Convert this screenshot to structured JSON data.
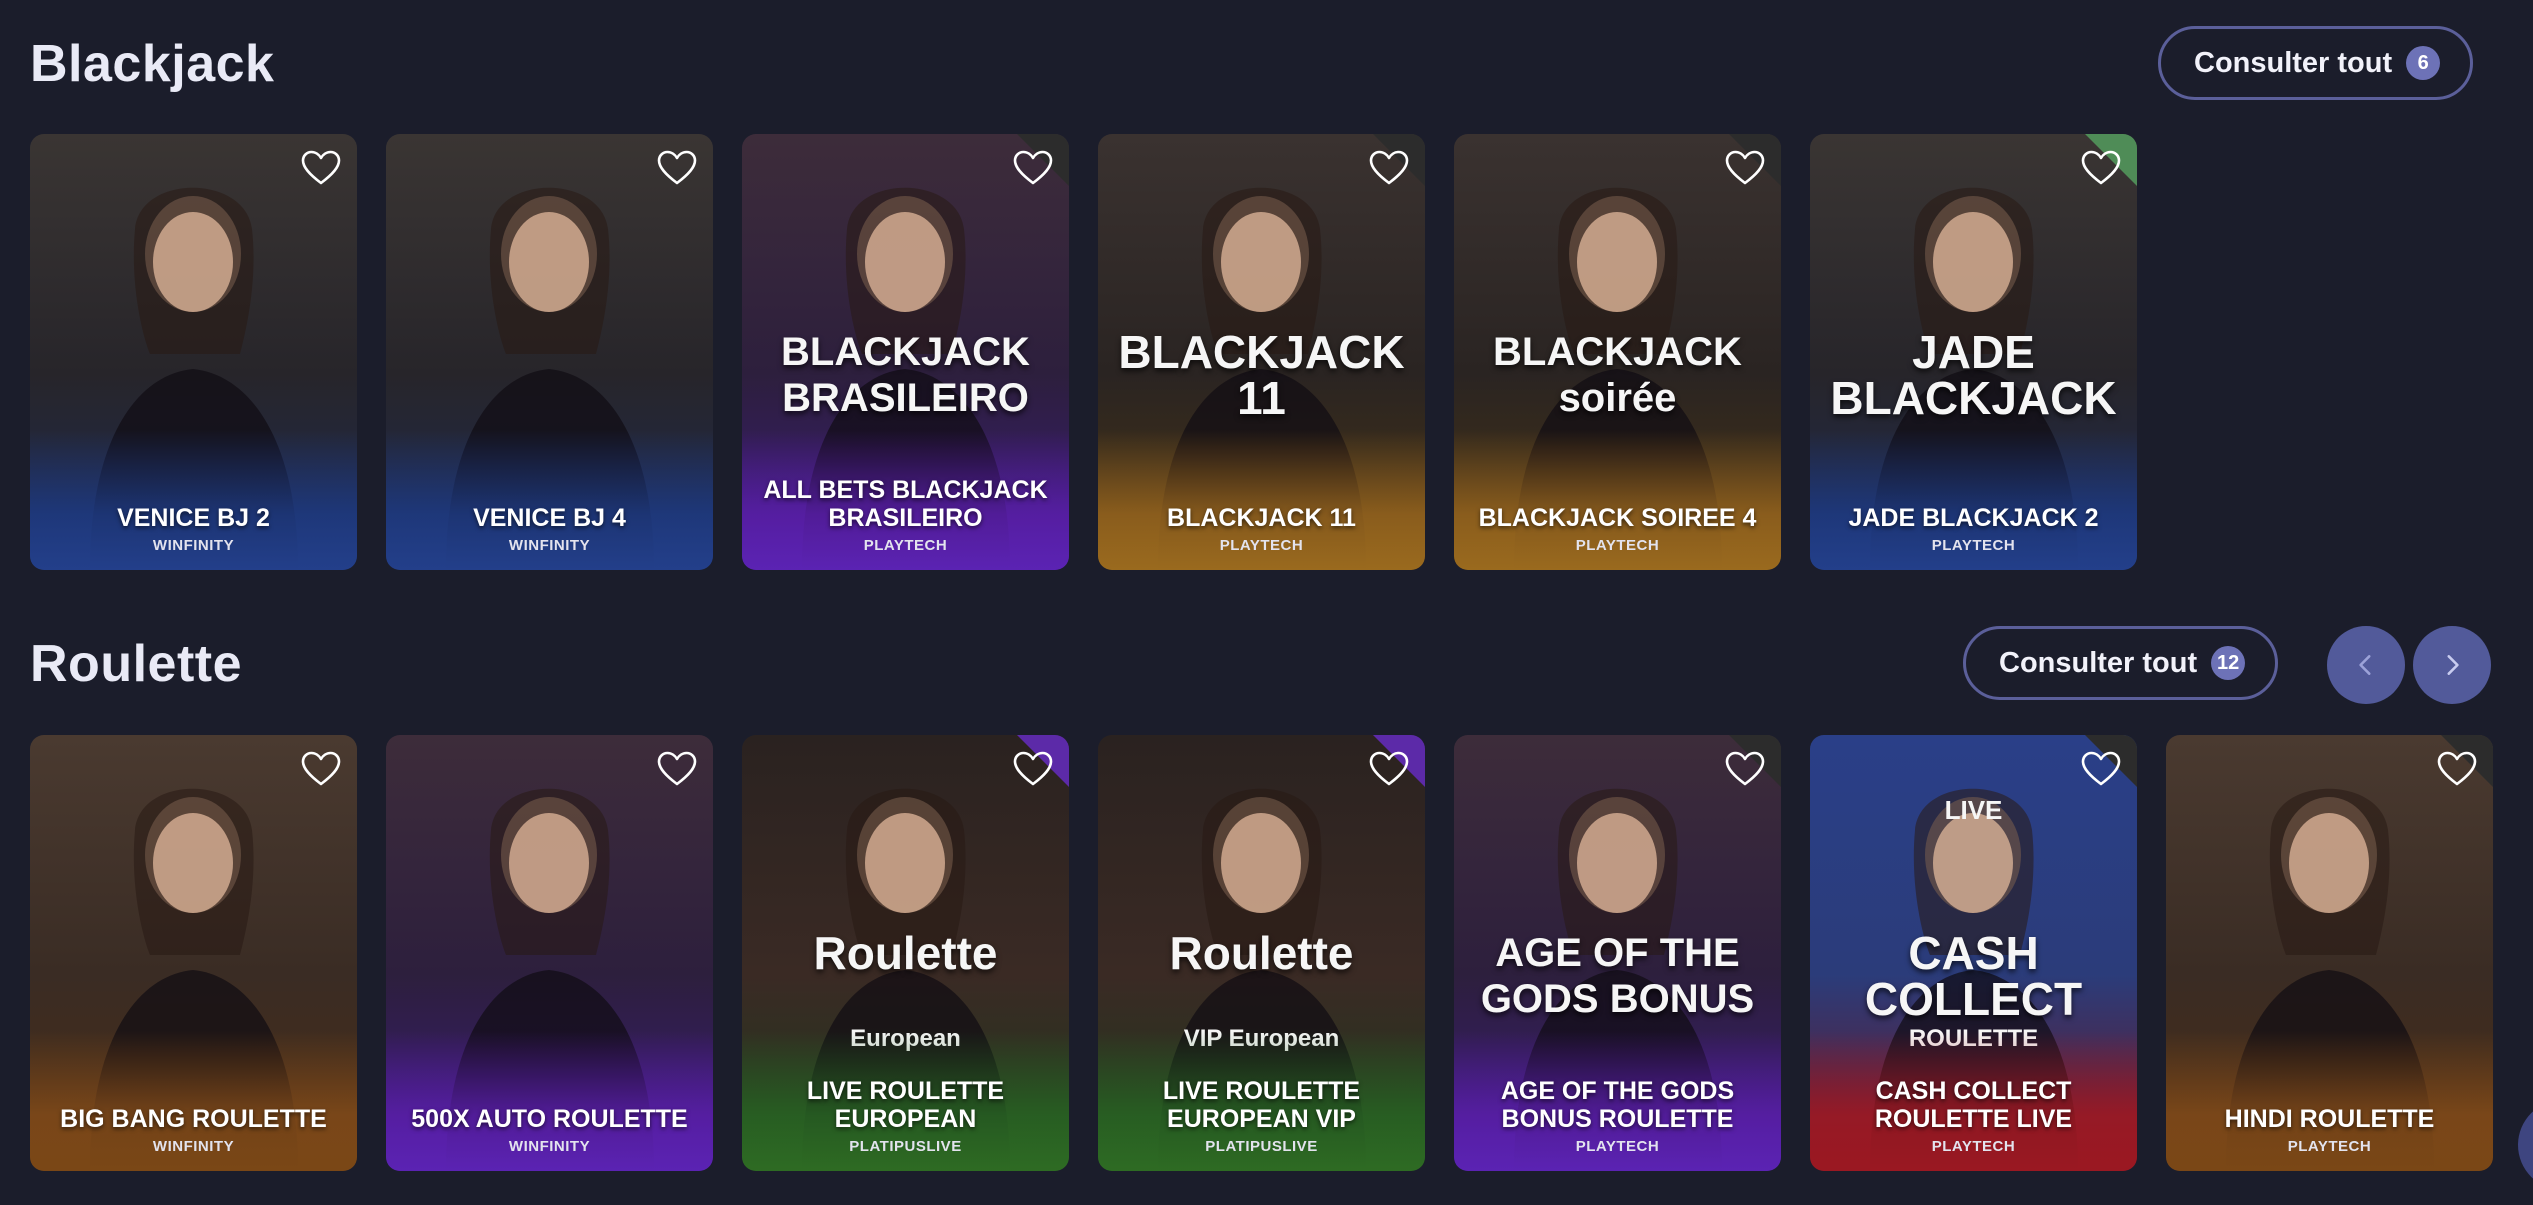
{
  "sections": [
    {
      "title": "Blackjack",
      "consult_label": "Consulter tout",
      "consult_count": "6",
      "games": [
        {
          "name": "VENICE BJ 2",
          "provider": "WINFINITY",
          "theme": "blue"
        },
        {
          "name": "VENICE BJ 4",
          "provider": "WINFINITY",
          "theme": "blue"
        },
        {
          "name": "ALL BETS BLACKJACK BRASILEIRO",
          "provider": "PLAYTECH",
          "theme": "purple",
          "logo": "BLACKJACK BRASILEIRO"
        },
        {
          "name": "BLACKJACK 11",
          "provider": "PLAYTECH",
          "theme": "gold",
          "logo": "BLACKJACK 11"
        },
        {
          "name": "BLACKJACK SOIREE 4",
          "provider": "PLAYTECH",
          "theme": "gold",
          "logo": "BLACKJACK soirée"
        },
        {
          "name": "JADE BLACKJACK 2",
          "provider": "PLAYTECH",
          "theme": "blue",
          "logo": "JADE BLACKJACK"
        }
      ]
    },
    {
      "title": "Roulette",
      "consult_label": "Consulter tout",
      "consult_count": "12",
      "games": [
        {
          "name": "BIG BANG ROULETTE",
          "provider": "WINFINITY",
          "theme": "brown"
        },
        {
          "name": "500X AUTO ROULETTE",
          "provider": "WINFINITY",
          "theme": "purple"
        },
        {
          "name": "LIVE ROULETTE EUROPEAN",
          "provider": "PLATIPUSLIVE",
          "theme": "green",
          "logo": "Roulette",
          "logo_sub": "European"
        },
        {
          "name": "LIVE ROULETTE EUROPEAN VIP",
          "provider": "PLATIPUSLIVE",
          "theme": "green",
          "logo": "Roulette",
          "logo_sub": "VIP European"
        },
        {
          "name": "AGE OF THE GODS BONUS ROULETTE",
          "provider": "PLAYTECH",
          "theme": "purple",
          "logo": "AGE OF THE GODS BONUS"
        },
        {
          "name": "CASH COLLECT ROULETTE LIVE",
          "provider": "PLAYTECH",
          "theme": "red",
          "logo": "CASH COLLECT",
          "logo_sub": "ROULETTE",
          "logo_top": "LIVE"
        },
        {
          "name": "HINDI ROULETTE",
          "provider": "PLAYTECH",
          "theme": "brown"
        }
      ]
    }
  ],
  "icons": {
    "favorite": "heart-outline-icon",
    "prev": "chevron-left-icon",
    "next": "chevron-right-icon"
  },
  "colors": {
    "background": "#1b1d2b",
    "accent": "#525a9a",
    "badge": "#6d72b7"
  }
}
